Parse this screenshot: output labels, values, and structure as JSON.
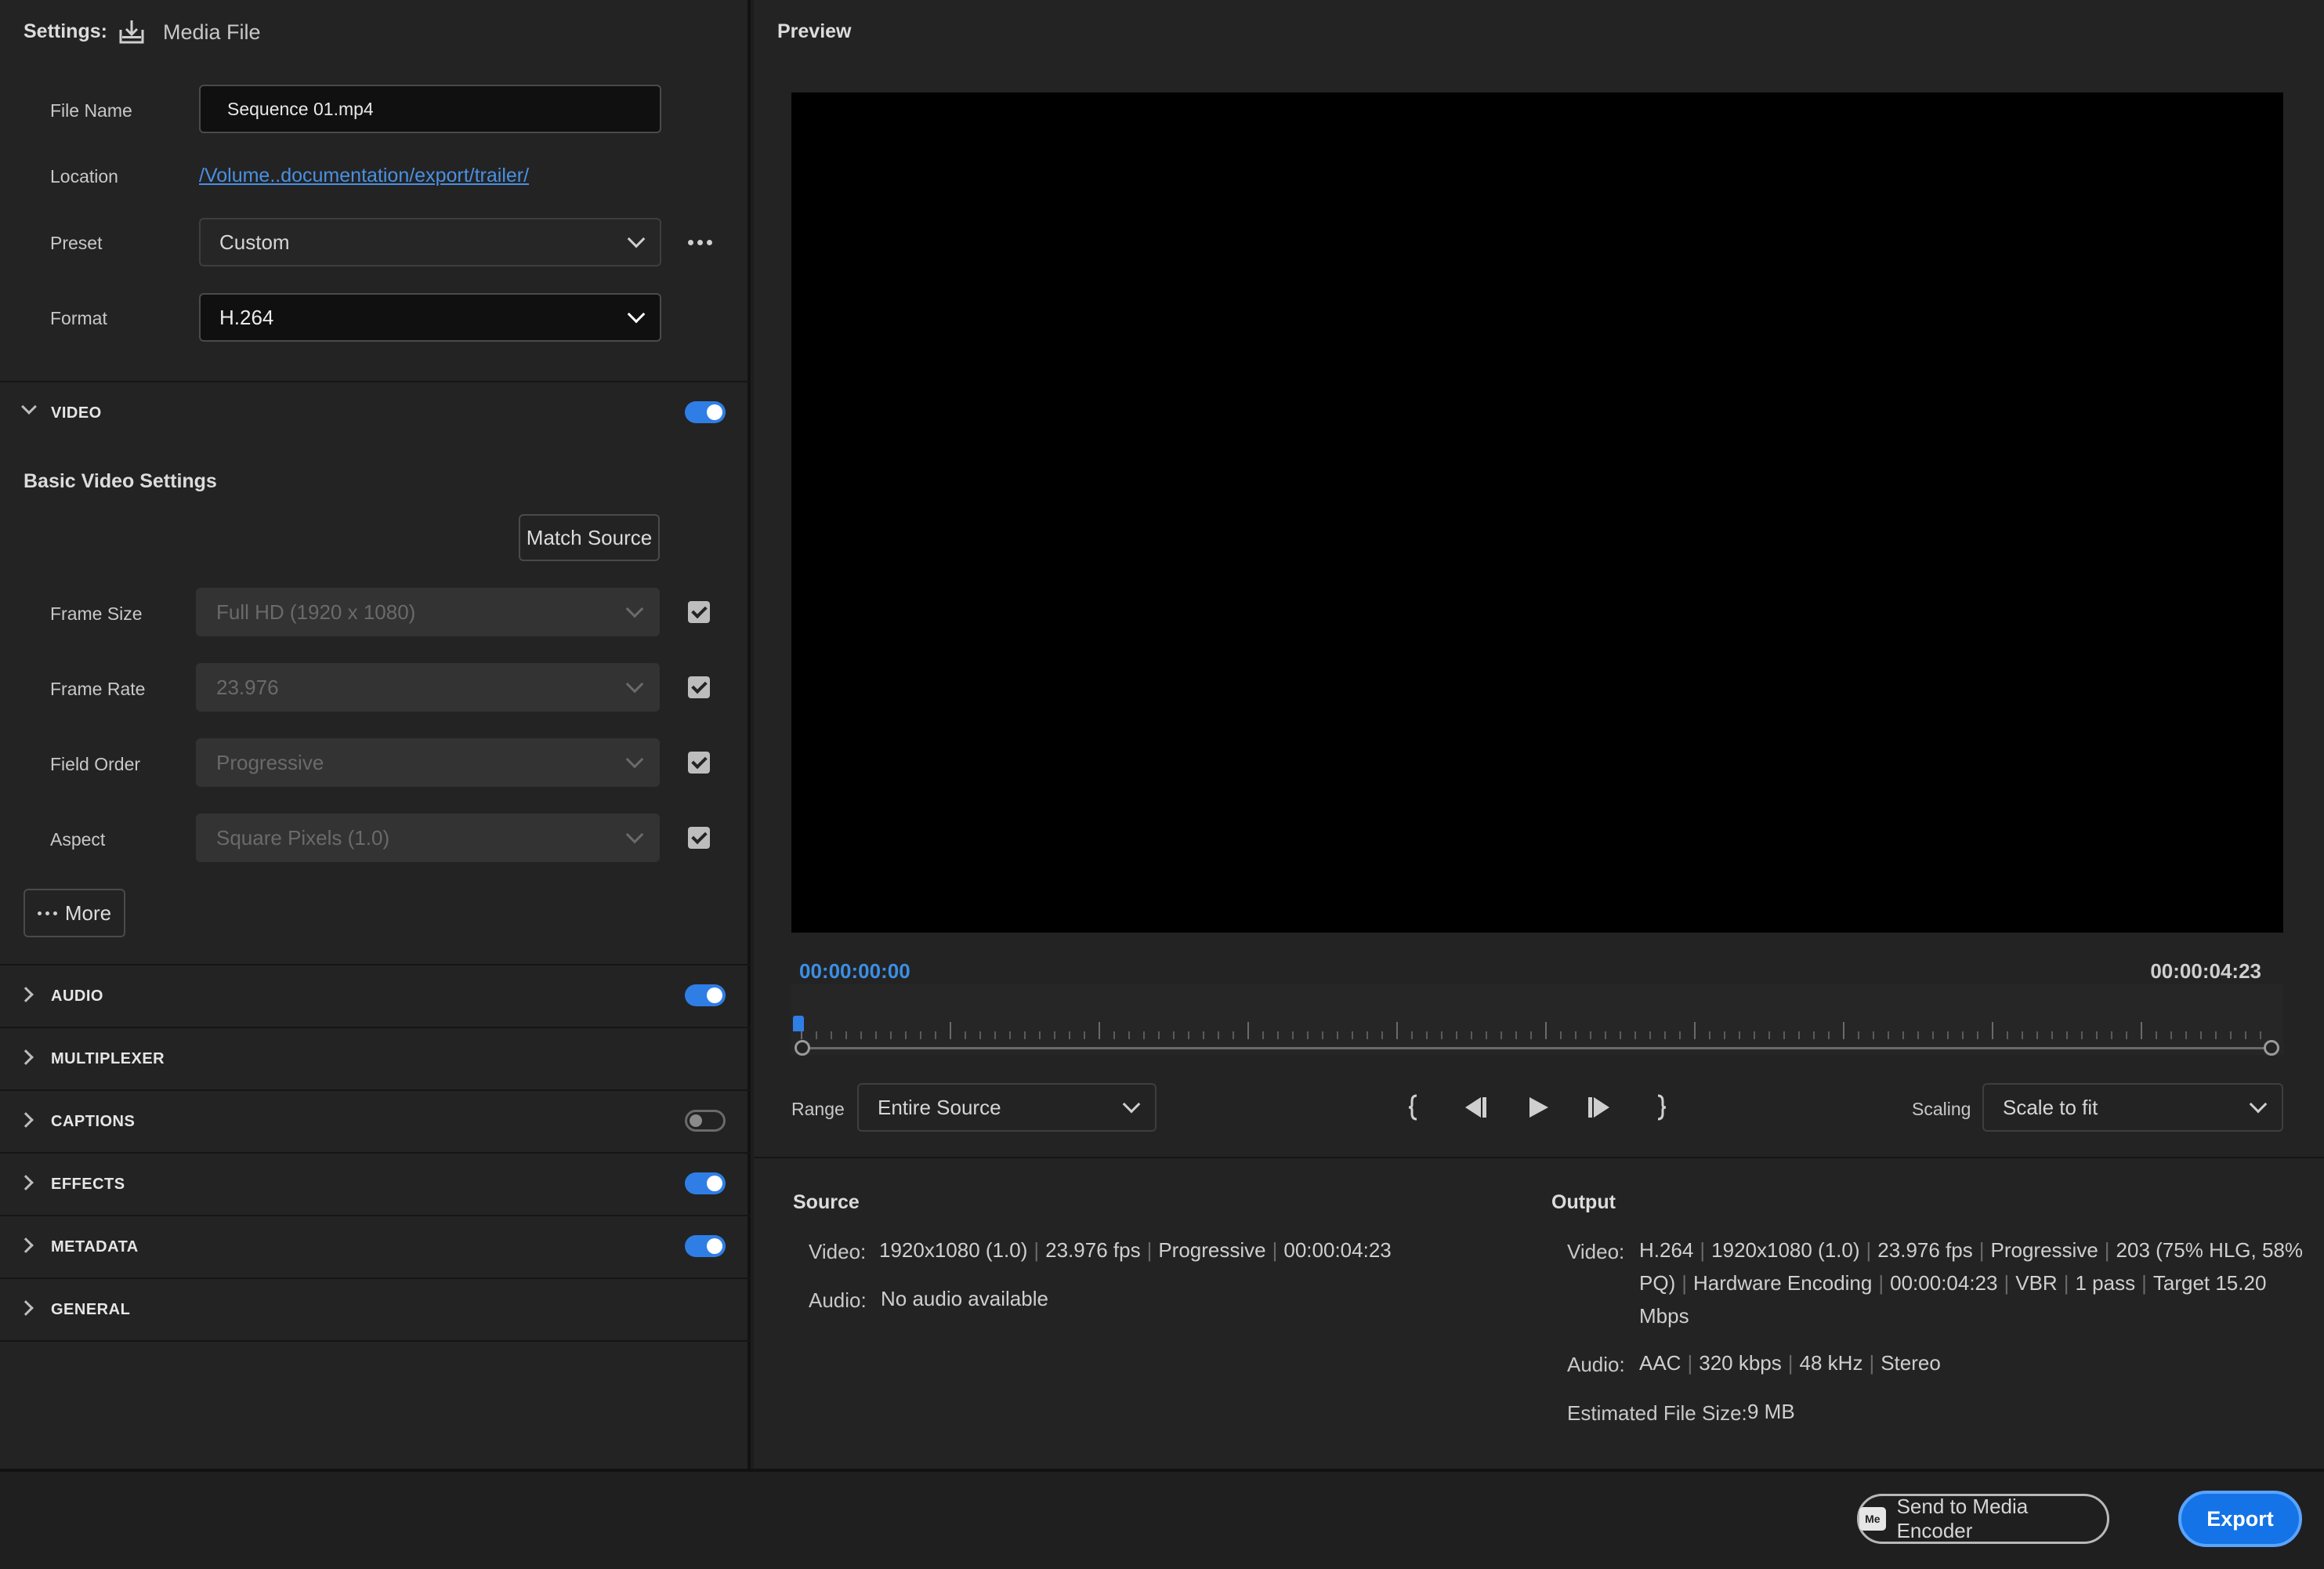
{
  "settings": {
    "title": "Settings:",
    "destination": "Media File",
    "file_name_label": "File Name",
    "file_name_value": "Sequence 01.mp4",
    "location_label": "Location",
    "location_value": "/Volume..documentation/export/trailer/",
    "preset_label": "Preset",
    "preset_value": "Custom",
    "format_label": "Format",
    "format_value": "H.264"
  },
  "video_section": {
    "label": "VIDEO",
    "enabled": true,
    "basic_title": "Basic Video Settings",
    "match_source": "Match Source",
    "rows": [
      {
        "label": "Frame Size",
        "value": "Full HD (1920 x 1080)"
      },
      {
        "label": "Frame Rate",
        "value": "23.976"
      },
      {
        "label": "Field Order",
        "value": "Progressive"
      },
      {
        "label": "Aspect",
        "value": "Square Pixels (1.0)"
      }
    ],
    "more_label": "More"
  },
  "sections": [
    {
      "label": "AUDIO",
      "toggle": "on"
    },
    {
      "label": "MULTIPLEXER",
      "toggle": "none"
    },
    {
      "label": "CAPTIONS",
      "toggle": "off"
    },
    {
      "label": "EFFECTS",
      "toggle": "on"
    },
    {
      "label": "METADATA",
      "toggle": "on"
    },
    {
      "label": "GENERAL",
      "toggle": "none"
    }
  ],
  "preview": {
    "title": "Preview",
    "timecode_current": "00:00:00:00",
    "timecode_end": "00:00:04:23",
    "range_label": "Range",
    "range_value": "Entire Source",
    "scaling_label": "Scaling",
    "scaling_value": "Scale to fit"
  },
  "source": {
    "title": "Source",
    "video_label": "Video:",
    "video_parts": [
      "1920x1080 (1.0)",
      "23.976 fps",
      "Progressive",
      "00:00:04:23"
    ],
    "audio_label": "Audio:",
    "audio_value": "No audio available"
  },
  "output": {
    "title": "Output",
    "video_label": "Video:",
    "video_line1": [
      "H.264",
      "1920x1080 (1.0)",
      "23.976 fps",
      "Progressive",
      "203 (75% HLG, 58%"
    ],
    "video_line2": [
      "PQ)",
      "Hardware Encoding",
      "00:00:04:23",
      "VBR",
      "1 pass",
      "Target 15.20"
    ],
    "video_line3": "Mbps",
    "audio_label": "Audio:",
    "audio_parts": [
      "AAC",
      "320 kbps",
      "48 kHz",
      "Stereo"
    ],
    "size_label": "Estimated File Size:",
    "size_value": "9 MB"
  },
  "footer": {
    "encoder_icon": "Me",
    "encoder_button": "Send to Media Encoder",
    "export_button": "Export"
  },
  "colors": {
    "accent": "#1473e6",
    "link": "#4a90e2",
    "timecode": "#3b8fe6"
  }
}
